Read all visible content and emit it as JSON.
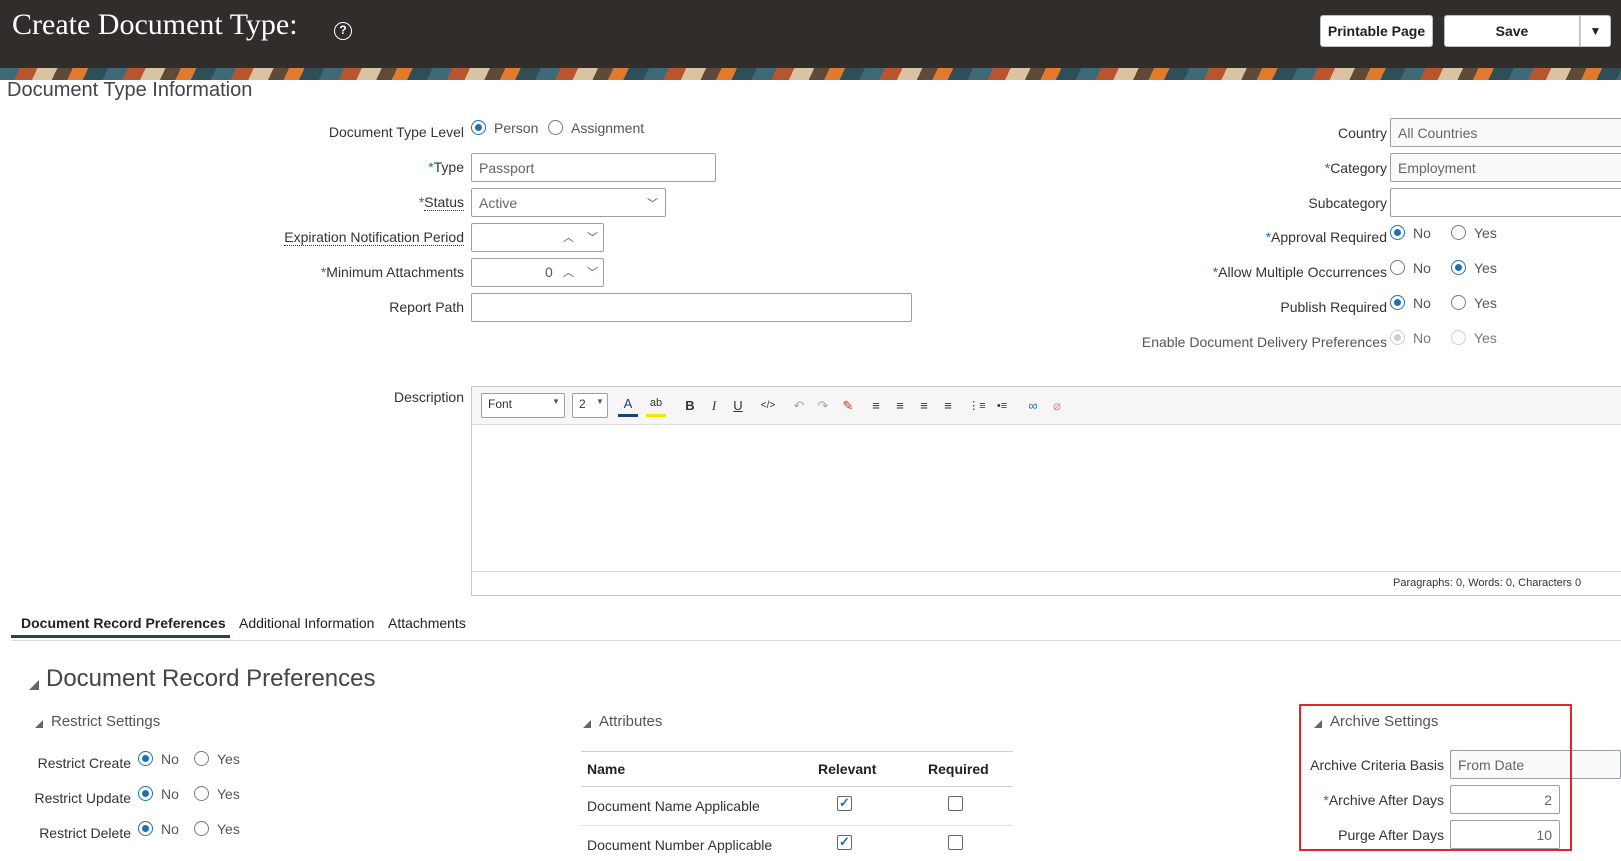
{
  "header": {
    "title": "Create Document Type:",
    "help_icon": "?",
    "printable_label": "Printable Page",
    "save_label": "Save",
    "save_menu_icon": "▼"
  },
  "doc_info": {
    "section_title": "Document Type Information",
    "level_label": "Document Type Level",
    "level_options": [
      "Person",
      "Assignment"
    ],
    "level_selected": "Person",
    "type_label": "Type",
    "type_value": "Passport",
    "status_label": "Status",
    "status_value": "Active",
    "expiration_label": "Expiration Notification Period",
    "expiration_value": "",
    "min_attach_label": "Minimum Attachments",
    "min_attach_value": "0",
    "report_path_label": "Report Path",
    "report_path_value": "",
    "country_label": "Country",
    "country_value": "All Countries",
    "category_label": "Category",
    "category_value": "Employment",
    "subcategory_label": "Subcategory",
    "subcategory_value": "",
    "approval_label": "Approval Required",
    "allow_multi_label": "Allow Multiple Occurrences",
    "publish_label": "Publish Required",
    "delivery_label": "Enable Document Delivery Preferences",
    "no": "No",
    "yes": "Yes",
    "approval_selected": "No",
    "allow_multi_selected": "Yes",
    "publish_selected": "No",
    "delivery_selected": "No"
  },
  "description": {
    "label": "Description",
    "font_select": "Font",
    "size_select": "2",
    "status_bar": "Paragraphs: 0, Words: 0, Characters 0"
  },
  "toolbar_icons": [
    "font-color-icon",
    "highlight-icon",
    "bold-icon",
    "italic-icon",
    "underline-icon",
    "source-code-icon",
    "undo-icon",
    "redo-icon",
    "clear-format-icon",
    "align-left-icon",
    "align-center-icon",
    "align-right-icon",
    "justify-icon",
    "ordered-list-icon",
    "unordered-list-icon",
    "link-icon",
    "unlink-icon"
  ],
  "toolbar_glyphs": {
    "font_color": "A",
    "highlight": "ab",
    "bold": "B",
    "italic": "I",
    "underline": "U",
    "source": "</>",
    "undo": "↶",
    "redo": "↷",
    "clear": "✎",
    "align_left": "≡",
    "align_center": "≡",
    "align_right": "≡",
    "justify": "≡",
    "ordered_list": "⋮≡",
    "unordered_list": "•≡",
    "link": "∞",
    "unlink": "⌀"
  },
  "tabs": [
    {
      "label": "Document Record Preferences",
      "active": true
    },
    {
      "label": "Additional Information",
      "active": false
    },
    {
      "label": "Attachments",
      "active": false
    }
  ],
  "record_prefs": {
    "title": "Document Record Preferences",
    "restrict": {
      "title": "Restrict Settings",
      "create_label": "Restrict Create",
      "update_label": "Restrict Update",
      "delete_label": "Restrict Delete",
      "create_selected": "No",
      "update_selected": "No",
      "delete_selected": "No"
    },
    "attributes": {
      "title": "Attributes",
      "columns": [
        "Name",
        "Relevant",
        "Required"
      ],
      "rows": [
        {
          "name": "Document Name Applicable",
          "relevant": true,
          "required": false
        },
        {
          "name": "Document Number Applicable",
          "relevant": true,
          "required": false
        }
      ]
    },
    "archive": {
      "title": "Archive Settings",
      "criteria_label": "Archive Criteria Basis",
      "criteria_value": "From Date",
      "after_days_label": "Archive After Days",
      "after_days_value": "2",
      "purge_label": "Purge After Days",
      "purge_value": "10"
    }
  },
  "colors": {
    "header_bg": "#312d2a",
    "accent": "#1f6fb4",
    "highlight_box": "#e0262a"
  }
}
